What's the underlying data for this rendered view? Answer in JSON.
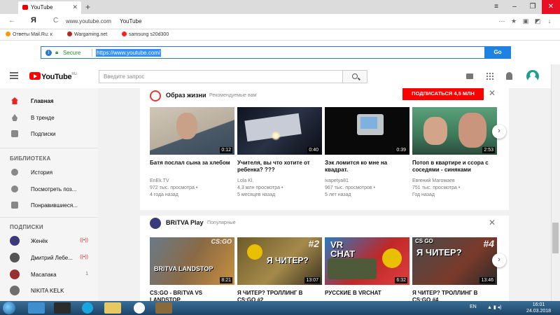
{
  "browser": {
    "tab_title": "YouTube",
    "new_tab": "+",
    "window_buttons": [
      "≡",
      "–",
      "❐",
      "✕"
    ],
    "back": "←",
    "yandex_logo": "Я",
    "reload": "C",
    "url_host": "www.youtube.com",
    "page_title": "YouTube",
    "bookmarks": [
      {
        "label": "Ответы Mail.Ru: к",
        "color": "#ff9b00"
      },
      {
        "label": "Wargaming.net",
        "color": "#b0281e"
      },
      {
        "label": "samsung s20d300",
        "color": "#ff2020"
      }
    ],
    "secure_label": "Secure",
    "full_url": "https://www.youtube.com/",
    "go_label": "Go"
  },
  "header": {
    "logo": "YouTube",
    "region": "RU",
    "search_placeholder": "Введите запрос"
  },
  "sidebar": {
    "nav": [
      {
        "label": "Главная",
        "icon": "home-icon"
      },
      {
        "label": "В тренде",
        "icon": "fire-icon"
      },
      {
        "label": "Подписки",
        "icon": "subscriptions-icon"
      }
    ],
    "library_heading": "БИБЛИОТЕКА",
    "library": [
      {
        "label": "История",
        "icon": "history-icon"
      },
      {
        "label": "Посмотреть поз...",
        "icon": "clock-icon"
      },
      {
        "label": "Понравившиеся...",
        "icon": "thumbs-up-icon"
      }
    ],
    "subs_heading": "ПОДПИСКИ",
    "subscriptions": [
      {
        "label": "Женёк",
        "badge": "((•))",
        "color": "#3a3a7a"
      },
      {
        "label": "Дмитрий Лебе...",
        "badge": "((•))",
        "color": "#555555"
      },
      {
        "label": "Масапака",
        "badge": "1",
        "color": "#9a2f2f"
      },
      {
        "label": "NIKITA KELK",
        "badge": "",
        "color": "#6e6e6e"
      }
    ]
  },
  "shelf1": {
    "title": "Образ жизни",
    "subtitle": "Рекомендуемые вам",
    "subscribe": "ПОДПИСАТЬСЯ 4,5 МЛН",
    "close": "✕",
    "videos": [
      {
        "title": "Батя послал сына за хлебом",
        "channel": "EnEk.TV",
        "views": "972 тыс. просмотра •",
        "age": "4 года назад",
        "duration": "0:12"
      },
      {
        "title": "Учителя, вы что хотите от ребенка? ???",
        "channel": "Lola Kl.",
        "views": "4,3 млн просмотра •",
        "age": "5 месяцев назад",
        "duration": "0:40"
      },
      {
        "title": "Зэк ломится ко мне на квадрат.",
        "channel": "ivapetya81",
        "views": "967 тыс. просмотров •",
        "age": "5 лет назад",
        "duration": "0:39"
      },
      {
        "title": "Потоп в квартире и ссора с соседями - синяками",
        "channel": "Евгений Магомаев",
        "views": "751 тыс. просмотра •",
        "age": "Год назад",
        "duration": "2:53"
      }
    ]
  },
  "shelf2": {
    "title": "BRiTVA Play",
    "subtitle": "Популярные",
    "close": "✕",
    "videos": [
      {
        "title": "CS:GO - BRiTVA VS LANDSTOP",
        "duration": "8:21",
        "overlay": "BRiTVA  LANDSTOP",
        "corner": "CS:GO"
      },
      {
        "title": "Я ЧИТЕР? ТРОЛЛИНГ В CS:GO #2",
        "duration": "13:07",
        "overlay": "Я ЧИТЕР?",
        "corner": "#2"
      },
      {
        "title": "РУССКИЕ В VRCHAT",
        "duration": "6:32",
        "overlay": "VR CHAT",
        "corner": ""
      },
      {
        "title": "Я ЧИТЕР? ТРОЛЛИНГ В CS:GO #4",
        "duration": "13:46",
        "overlay": "Я ЧИТЕР?",
        "corner": "#4"
      }
    ]
  },
  "arrow": "›",
  "taskbar": {
    "lang": "EN",
    "time": "16:01",
    "date": "24.03.2018"
  },
  "colors": {
    "youtube_red": "#ff0000",
    "secure_green": "#2a8a2a",
    "go_blue": "#1f82e0"
  }
}
